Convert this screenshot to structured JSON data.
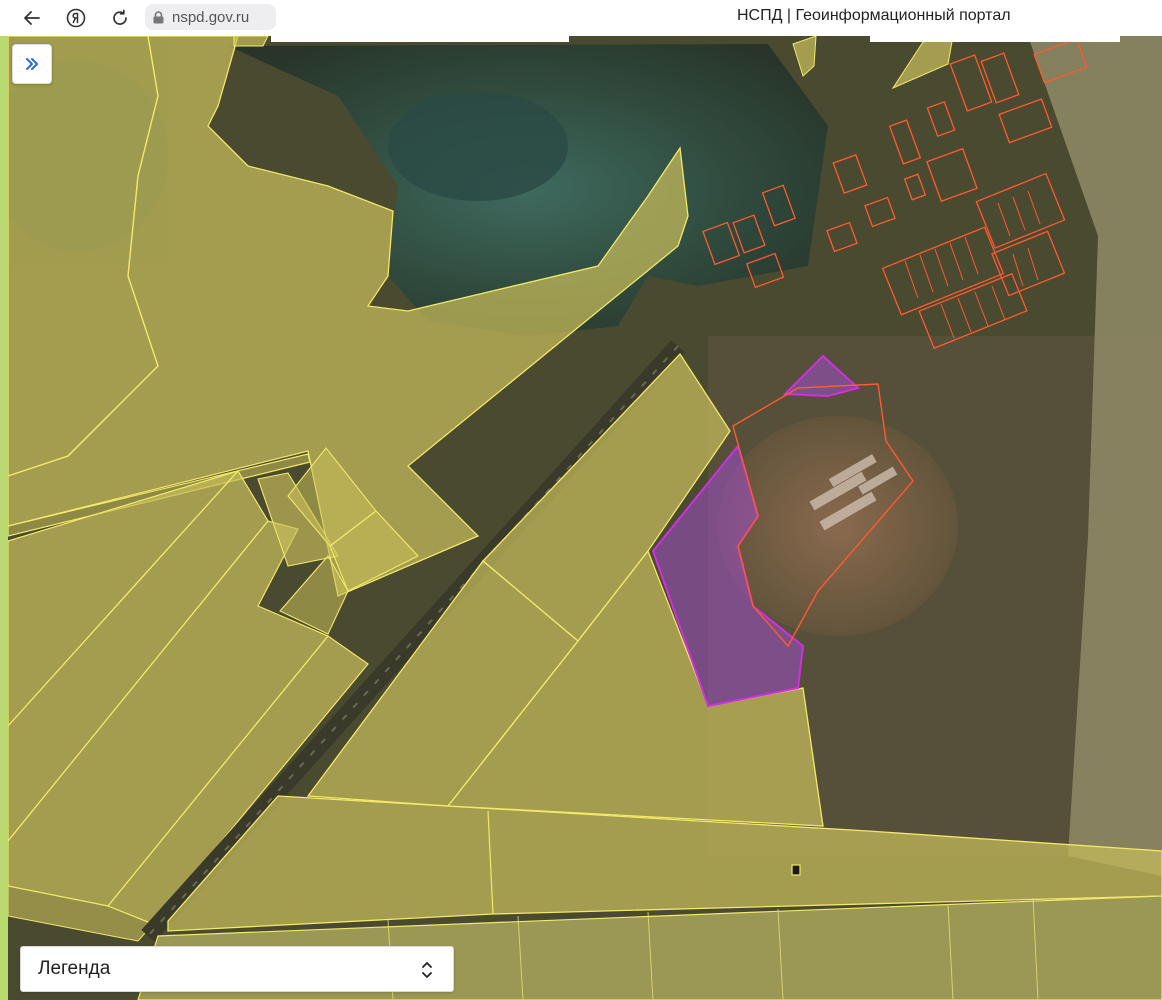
{
  "browser": {
    "url": "nspd.gov.ru",
    "title": "НСПД | Геоинформационный портал"
  },
  "map": {
    "legend_label": "Легенда"
  },
  "colors": {
    "parcel_fill": "#c8bd5a",
    "parcel_border": "#f2e86a",
    "settlement_border": "#ff5a30",
    "selected_fill": "#a04cc8",
    "selected_border": "#d030e0",
    "accent": "#2a6bd8"
  },
  "icons": {
    "back": "arrow-left-icon",
    "yandex": "yandex-logo-icon",
    "reload": "reload-icon",
    "lock": "lock-icon",
    "panel": "double-chevron-right-icon",
    "legend": "chevron-up-down-icon"
  }
}
